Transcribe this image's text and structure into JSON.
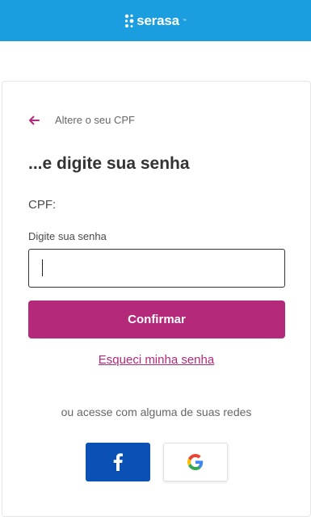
{
  "header": {
    "logo_text": "serasa",
    "logo_tm": "™",
    "background": "#1a9ee0"
  },
  "nav": {
    "back_label": "Altere o seu CPF",
    "back_icon": "arrow-left-icon"
  },
  "form": {
    "title": "...e digite sua senha",
    "cpf_label": "CPF:",
    "cpf_value": "",
    "password_label": "Digite sua senha",
    "password_value": "",
    "confirm_label": "Confirmar",
    "forgot_link": "Esqueci minha senha"
  },
  "social": {
    "label": "ou acesse com alguma de suas redes",
    "providers": [
      {
        "id": "facebook",
        "icon": "facebook-icon"
      },
      {
        "id": "google",
        "icon": "google-icon"
      }
    ]
  },
  "colors": {
    "accent": "#b5297a",
    "facebook": "#0b50b4",
    "text": "#333333",
    "muted": "#666666"
  }
}
